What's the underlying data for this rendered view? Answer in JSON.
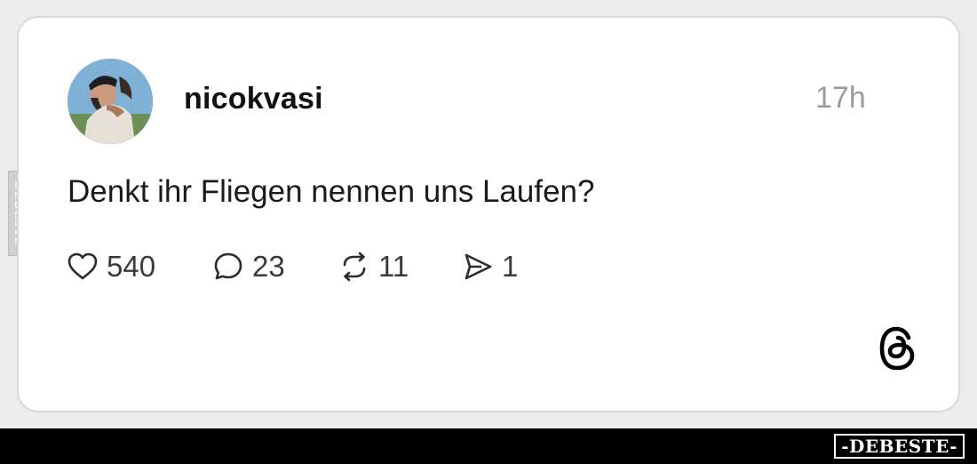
{
  "post": {
    "username": "nicokvasi",
    "timestamp": "17h",
    "text": "Denkt ihr Fliegen nennen uns Laufen?",
    "actions": {
      "likes": "540",
      "replies": "23",
      "reposts": "11",
      "shares": "1"
    },
    "icons": {
      "like": "heart-icon",
      "reply": "comment-bubble-icon",
      "repost": "repost-arrows-icon",
      "share": "send-icon",
      "brand": "threads-logo-icon"
    }
  },
  "watermark": {
    "side_label": "DEBESTE",
    "footer_label": "-DEBESTE-"
  },
  "colors": {
    "card_background": "#ffffff",
    "card_border": "#d9d9d9",
    "text_primary": "#111111",
    "text_muted": "#9b9b9b",
    "footer_bar": "#000000"
  }
}
